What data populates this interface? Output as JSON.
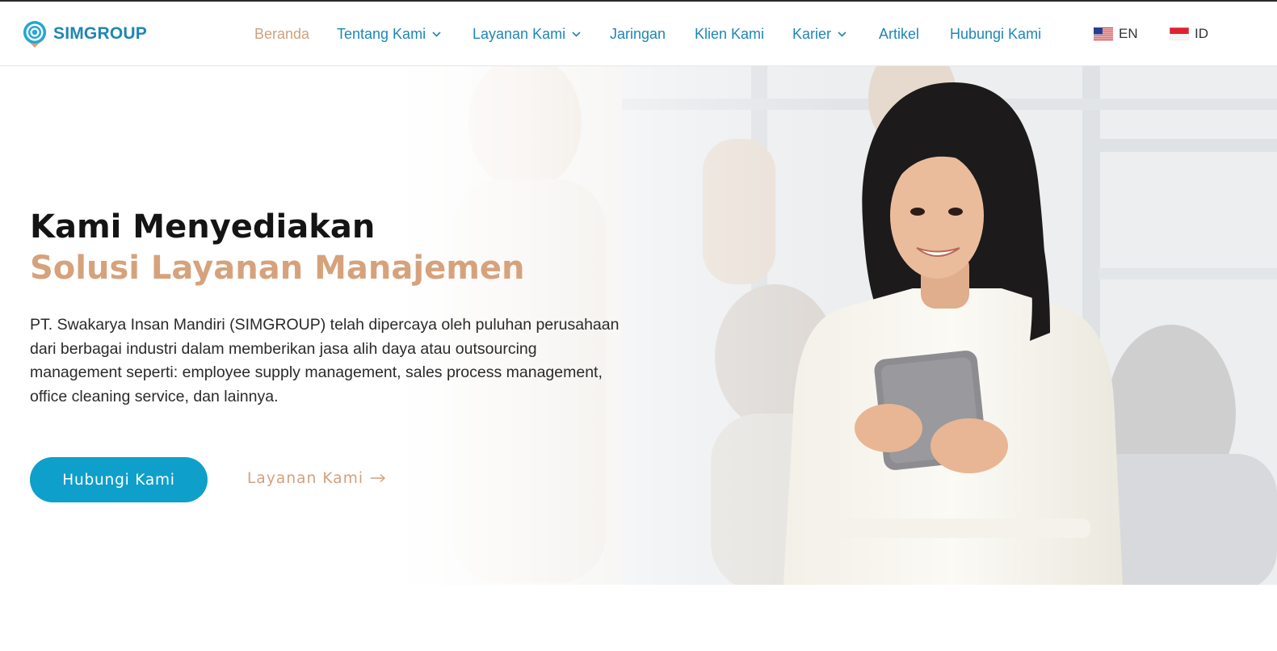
{
  "brand": {
    "name": "SIMGROUP",
    "primary_color": "#1f86b4",
    "accent_color": "#d6a27c"
  },
  "nav": {
    "items": [
      {
        "label": "Beranda",
        "active": true,
        "dropdown": false
      },
      {
        "label": "Tentang Kami",
        "active": false,
        "dropdown": true
      },
      {
        "label": "Layanan Kami",
        "active": false,
        "dropdown": true
      },
      {
        "label": "Jaringan",
        "active": false,
        "dropdown": false
      },
      {
        "label": "Klien Kami",
        "active": false,
        "dropdown": false
      },
      {
        "label": "Karier",
        "active": false,
        "dropdown": true
      },
      {
        "label": "Artikel",
        "active": false,
        "dropdown": false
      },
      {
        "label": "Hubungi Kami",
        "active": false,
        "dropdown": false
      }
    ],
    "languages": [
      {
        "code": "EN",
        "flag": "us-flag-icon"
      },
      {
        "code": "ID",
        "flag": "id-flag-icon"
      }
    ]
  },
  "hero": {
    "title_line1": "Kami Menyediakan",
    "title_line2": "Solusi Layanan Manajemen",
    "description": "PT. Swakarya Insan Mandiri (SIMGROUP) telah dipercaya oleh puluhan perusahaan dari berbagai industri dalam memberikan jasa alih daya atau outsourcing management seperti: employee supply management, sales process management, office cleaning service, dan lainnya.",
    "primary_button": "Hubungi Kami",
    "secondary_link": "Layanan Kami",
    "button_color": "#0f9fcb"
  }
}
